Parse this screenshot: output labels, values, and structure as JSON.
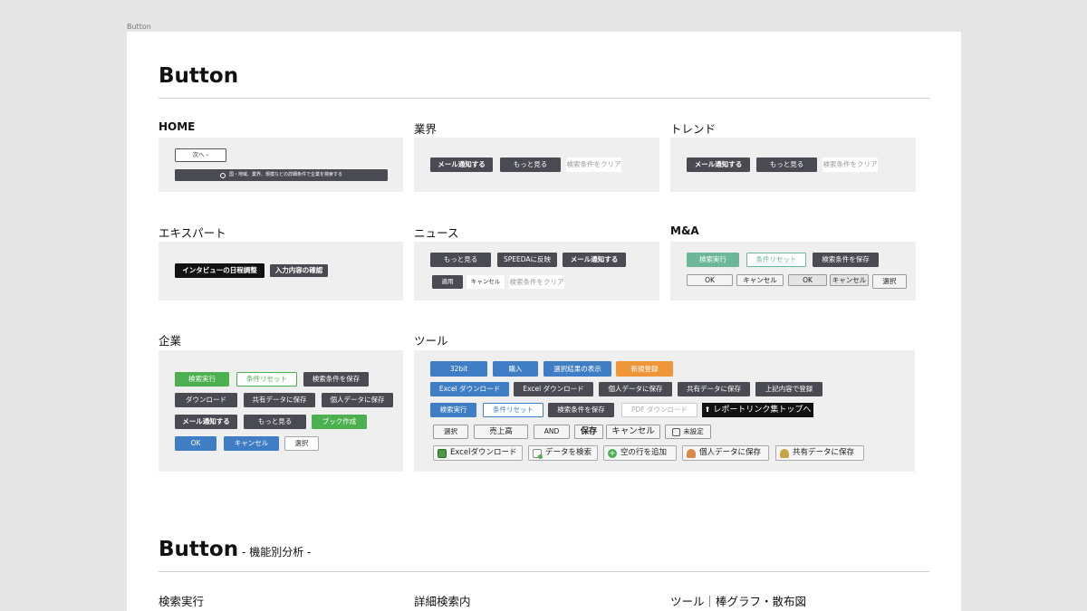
{
  "frame_label": "Button",
  "page_title": "Button",
  "page_title2": "Button",
  "page_title2_sub": "- 機能別分析 -",
  "sections": {
    "home": {
      "title": "HOME",
      "next": "次へ ›",
      "search": "国・地域、業界、規模などの詳細条件で企業を検索する"
    },
    "industry": {
      "title": "業界",
      "mail": "メール通知する",
      "more": "もっと見る",
      "clear": "検索条件をクリア"
    },
    "trend": {
      "title": "トレンド",
      "mail": "メール通知する",
      "more": "もっと見る",
      "clear": "検索条件をクリア"
    },
    "expert": {
      "title": "エキスパート",
      "schedule": "インタビューの日程調整",
      "confirm": "入力内容の確認"
    },
    "news": {
      "title": "ニュース",
      "more": "もっと見る",
      "speeda": "SPEEDAに反映",
      "mail": "メール通知する",
      "apply": "適用",
      "cancel": "キャンセル",
      "clear": "検索条件をクリア"
    },
    "ma": {
      "title": "M&A",
      "search": "検索実行",
      "reset": "条件リセット",
      "save": "検索条件を保存",
      "ok1": "OK",
      "cancel1": "キャンセル",
      "ok2": "OK",
      "cancel2": "キャンセル",
      "select": "選択"
    },
    "company": {
      "title": "企業",
      "search": "検索実行",
      "reset": "条件リセット",
      "save": "検索条件を保存",
      "download": "ダウンロード",
      "save_shared": "共有データに保存",
      "save_personal": "個人データに保存",
      "mail": "メール通知する",
      "more": "もっと見る",
      "book": "ブック作成",
      "ok": "OK",
      "cancel": "キャンセル",
      "select": "選択"
    },
    "tool": {
      "title": "ツール",
      "bit32": "32bit",
      "buy": "購入",
      "show_selected": "選択結果の表示",
      "new_register": "新規登録",
      "excel_dl1": "Excel ダウンロード",
      "excel_dl2": "Excel ダウンロード",
      "save_personal": "個人データに保存",
      "save_shared": "共有データに保存",
      "register_above": "上記内容で登録",
      "search": "検索実行",
      "reset": "条件リセット",
      "save_cond": "検索条件を保存",
      "pdf_dl": "PDF ダウンロード",
      "report_top": "レポートリンク集トップへ",
      "select": "選択",
      "sales": "売上高",
      "and": "AND",
      "save": "保存",
      "cancel": "キャンセル",
      "unset": "未設定",
      "excel_icon": "Excelダウンロード",
      "search_data": "データを検索",
      "add_row": "空の行を追加",
      "personal_icon": "個人データに保存",
      "shared_icon": "共有データに保存"
    },
    "bottom": {
      "search_exec": "検索実行",
      "detail_search": "詳細検索内",
      "tool_chart": "ツール｜棒グラフ・散布図"
    }
  }
}
